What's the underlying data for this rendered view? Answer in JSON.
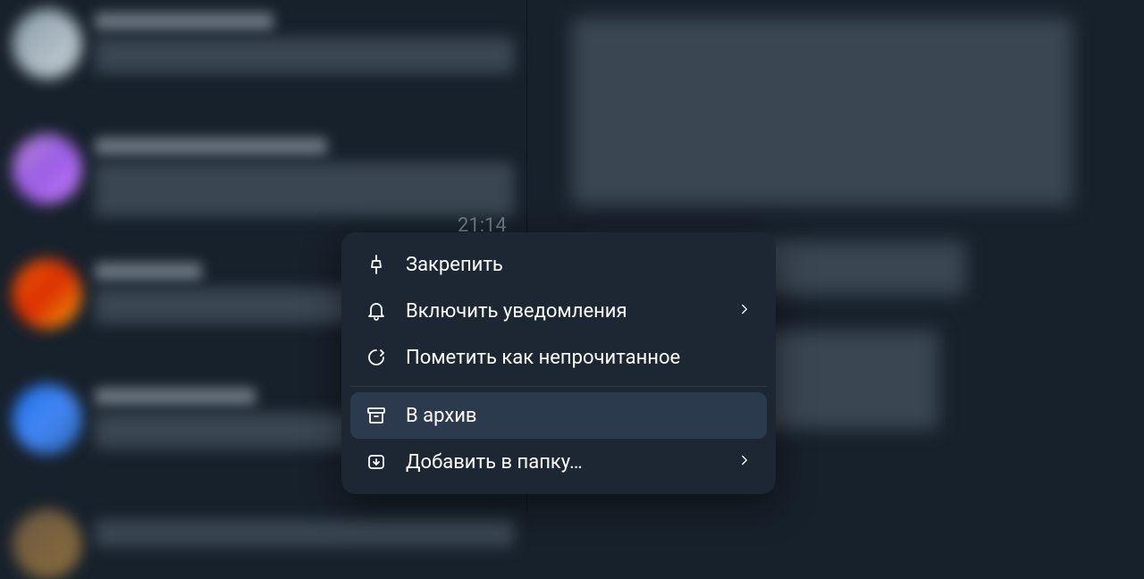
{
  "chat_time_visible": "21:14",
  "context_menu": {
    "pin_label": "Закрепить",
    "notifications_label": "Включить уведомления",
    "mark_unread_label": "Пометить как непрочитанное",
    "archive_label": "В архив",
    "add_to_folder_label": "Добавить в папку…"
  },
  "icon_names": {
    "pin": "pin-icon",
    "bell": "bell-icon",
    "chat_unread": "chat-unread-icon",
    "archive": "archive-icon",
    "folder": "folder-add-icon",
    "chevron": "chevron-right-icon"
  },
  "colors": {
    "bg": "#17212b",
    "menu_bg": "#1c2733",
    "hover": "#2b3b4d",
    "text": "#ffffff",
    "muted": "#6d7883"
  }
}
